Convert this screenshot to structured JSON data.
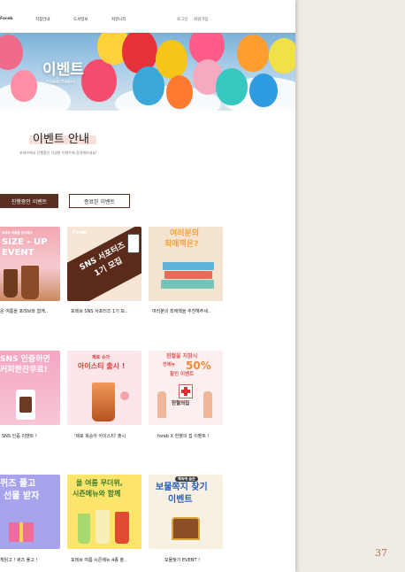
{
  "nav": {
    "logo": "Foreb",
    "items": [
      "지점안내",
      "도서정보",
      "커뮤니티"
    ],
    "login": "로그인",
    "signup": "회원가입"
  },
  "hero": {
    "title": "이벤트",
    "subtitle": "Foreb Event"
  },
  "section": {
    "title": "이벤트 안내",
    "description": "포레브에서 진행중인 다양한 이벤트에 참여해보세요!"
  },
  "tabs": {
    "active": "진행중인 이벤트",
    "inactive": "종료된 이벤트"
  },
  "cards": [
    {
      "caption": "운 여름을 포레브와 함께..",
      "lines": [
        "포레브 여름을 맞이해서",
        "SIZE - UP",
        "EVENT"
      ]
    },
    {
      "caption": "포레브 SNS 서포터즈 1기 모..",
      "lines": [
        "Foreb",
        "SNS 서포터즈",
        "1기 모집"
      ]
    },
    {
      "caption": "여러분의 최애책을 추천해주세..",
      "lines": [
        "여러분의",
        "최애책은?"
      ]
    },
    {
      "caption": "SNS 인증 이벤트 !",
      "lines": [
        "SNS 인증하면",
        "커피한잔무료!"
      ]
    },
    {
      "caption": "'제로 복숭아 아이스티' 출시",
      "lines": [
        "제로 슈가",
        "아이스티 출시 !"
      ]
    },
    {
      "caption": "foreb X 헌혈의 집 이벤트 !",
      "lines": [
        "헌혈을 지참시",
        "전메뉴",
        "50%",
        "할인 이벤트",
        "헌혈의집"
      ]
    },
    {
      "caption": "책읽고 ! 퀴즈 풀고 !",
      "lines": [
        "퀴즈 풀고",
        "선물 받자"
      ]
    },
    {
      "caption": "포레브 여름 시즌메뉴 4종 출..",
      "lines": [
        "올 여름 무더위,",
        "시즌메뉴와 함께"
      ]
    },
    {
      "caption": "보물찾기 EVENT !",
      "lines": [
        "책속에 숨은",
        "보물쪽지 찾기",
        "이벤트"
      ]
    }
  ],
  "page_number": "37"
}
